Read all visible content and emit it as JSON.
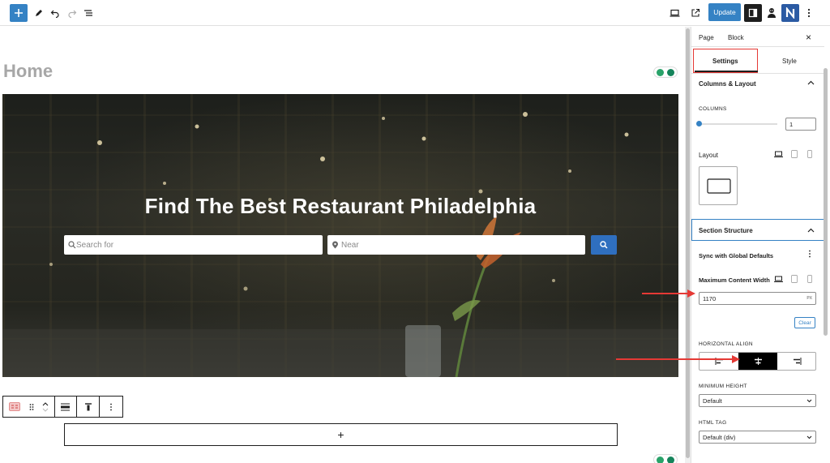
{
  "toolbar": {
    "add_icon": "plus-icon",
    "tools_icon": "pen-icon",
    "undo_icon": "undo-icon",
    "redo_icon": "redo-icon",
    "list_view_icon": "list-view-icon",
    "preview_icon": "desktop-preview-icon",
    "view_page_icon": "external-link-icon",
    "update_label": "Update",
    "options_icon": "more-vertical-icon"
  },
  "canvas": {
    "page_title": "Home",
    "hero": {
      "title": "Find The Best Restaurant Philadelphia",
      "search_placeholder": "Search for",
      "near_placeholder": "Near"
    },
    "appender_label": "+"
  },
  "sidebar": {
    "tabs": [
      "Page",
      "Block"
    ],
    "close_label": "×",
    "subtabs": [
      "Settings",
      "Style"
    ],
    "columns_layout": {
      "title": "Columns & Layout",
      "columns_label": "COLUMNS",
      "columns_value": "1",
      "columns_fraction": 0.0,
      "layout_label": "Layout"
    },
    "section_structure": {
      "title": "Section Structure",
      "sync_label": "Sync with Global Defaults",
      "max_width_label": "Maximum Content Width",
      "max_width_value": "1170",
      "unit": "PX",
      "clear_label": "Clear",
      "halign_label": "HORIZONTAL ALIGN",
      "halign_selected": "center",
      "min_height_label": "MINIMUM HEIGHT",
      "min_height_value": "Default",
      "html_tag_label": "HTML TAG",
      "html_tag_value": "Default (div)"
    }
  },
  "colors": {
    "accent": "#3582c4",
    "highlight": "#e53935",
    "search_button": "#2f6fbf"
  }
}
